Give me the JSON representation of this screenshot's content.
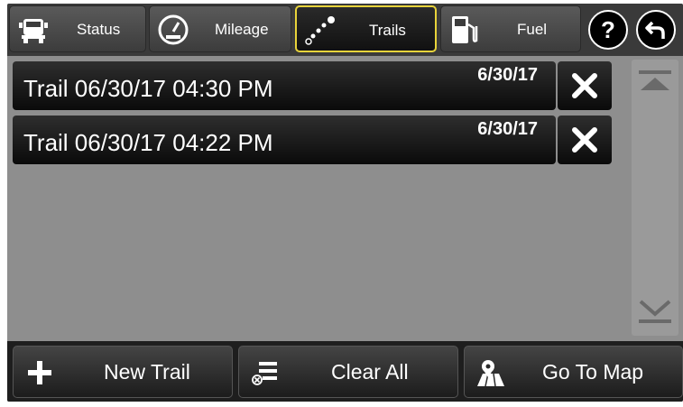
{
  "tabs": [
    {
      "label": "Status",
      "icon": "truck-icon",
      "active": false
    },
    {
      "label": "Mileage",
      "icon": "gauge-icon",
      "active": false
    },
    {
      "label": "Trails",
      "icon": "trail-dots-icon",
      "active": true
    },
    {
      "label": "Fuel",
      "icon": "fuel-pump-icon",
      "active": false
    }
  ],
  "header_buttons": {
    "help": "?",
    "back_icon": "back-arrow-icon"
  },
  "trails": [
    {
      "name": "Trail 06/30/17 04:30 PM",
      "date": "6/30/17"
    },
    {
      "name": "Trail 06/30/17 04:22 PM",
      "date": "6/30/17"
    }
  ],
  "bottom_buttons": [
    {
      "label": "New Trail",
      "icon": "plus-icon"
    },
    {
      "label": "Clear All",
      "icon": "clear-list-icon"
    },
    {
      "label": "Go To Map",
      "icon": "map-pin-icon"
    }
  ],
  "colors": {
    "active_tab_border": "#e8d33a",
    "background": "#8e8e8e"
  }
}
